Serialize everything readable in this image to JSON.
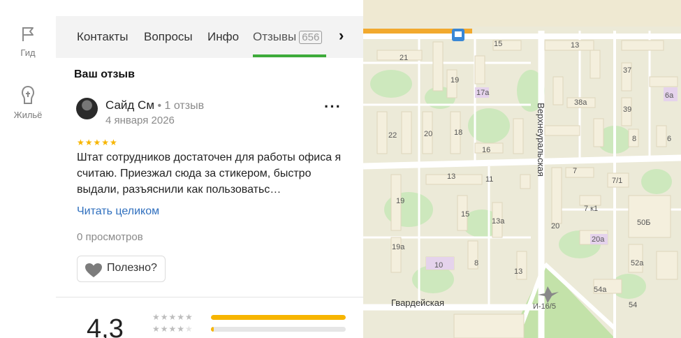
{
  "rail": {
    "items": [
      {
        "label": "Гид",
        "icon": "flag-icon"
      },
      {
        "label": "Жильё",
        "icon": "house-icon"
      }
    ]
  },
  "tabs": {
    "items": [
      {
        "label": "Контакты"
      },
      {
        "label": "Вопросы"
      },
      {
        "label": "Инфо"
      },
      {
        "label": "Отзывы",
        "count": "656",
        "active": true
      }
    ]
  },
  "review_section": {
    "title": "Ваш отзыв",
    "author": "Сайд См",
    "author_reviews": "1 отзыв",
    "date": "4 января 2026",
    "stars": 5,
    "text": "Штат сотрудников достаточен для работы офиса я считаю. Приезжал сюда за стикером, быстро выдали, разъяснили как пользоватьс…",
    "read_more": "Читать целиком",
    "views": "0 просмотров",
    "helpful": "Полезно?"
  },
  "rating": {
    "value": "4,3",
    "rows": [
      {
        "stars": 5,
        "share": 1.0
      },
      {
        "stars": 4,
        "share": 0.02
      }
    ]
  },
  "map": {
    "street_labels": [
      "Верхнеуральская",
      "Гвардейская"
    ],
    "building_labels": [
      "21",
      "19",
      "17а",
      "15",
      "13",
      "37",
      "6а",
      "38а",
      "39",
      "22",
      "20",
      "18",
      "16",
      "8",
      "6",
      "13",
      "11",
      "7",
      "7/1",
      "19",
      "15",
      "13а",
      "7 к1",
      "50Б",
      "20",
      "19а",
      "10",
      "8",
      "20а",
      "52а",
      "13",
      "54а",
      "И-16/5",
      "54"
    ],
    "colors": {
      "road": "#ffffff",
      "highway": "#f2a92e",
      "park": "#cde8bd",
      "building": "#f4efdd",
      "ground": "#ecead8"
    }
  },
  "colors": {
    "accent": "#3dab3a",
    "link": "#2f6fbe",
    "star": "#f7b500"
  }
}
